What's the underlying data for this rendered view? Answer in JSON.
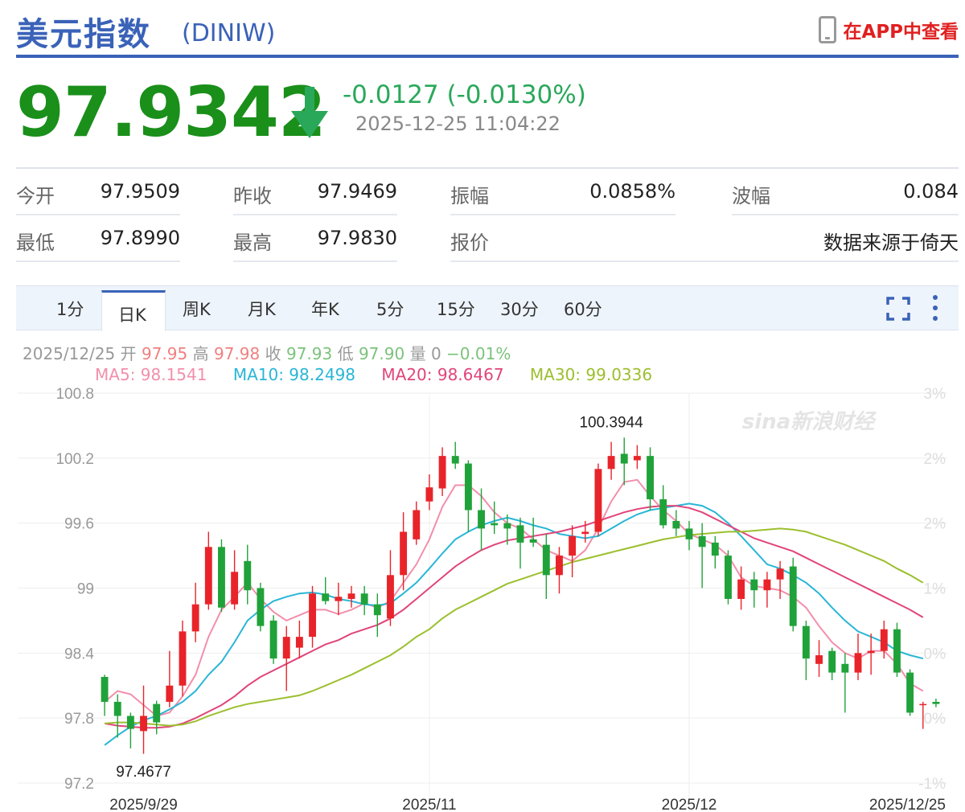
{
  "header": {
    "title": "美元指数",
    "code": "(DINIW)",
    "app_label": "在APP中查看",
    "icons": {
      "phone": "phone-icon"
    }
  },
  "quote": {
    "price": "97.9342",
    "change": "-0.0127 (-0.0130%)",
    "time": "2025-12-25 11:04:22",
    "direction": "down",
    "color": "#1a8f1a"
  },
  "stats": {
    "open_label": "今开",
    "open": "97.9509",
    "prev_close_label": "昨收",
    "prev_close": "97.9469",
    "amplitude_label": "振幅",
    "amplitude": "0.0858%",
    "range_label": "波幅",
    "range": "0.084",
    "low_label": "最低",
    "low": "97.8990",
    "high_label": "最高",
    "high": "97.9830",
    "quote_label": "报价",
    "source": "数据来源于倚天"
  },
  "tabs": [
    "1分",
    "日K",
    "周K",
    "月K",
    "年K",
    "5分",
    "15分",
    "30分",
    "60分"
  ],
  "active_tab": "日K",
  "info_bar": {
    "date": "2025/12/25",
    "open_label": "开",
    "open": "97.95",
    "high_label": "高",
    "high": "97.98",
    "close_label": "收",
    "close": "97.93",
    "low_label": "低",
    "low": "97.90",
    "vol_label": "量",
    "vol": "0",
    "pct": "−0.01%"
  },
  "ma_legend": [
    {
      "text": "MA5: 98.1541",
      "color": "#f28fab"
    },
    {
      "text": "MA10: 98.2498",
      "color": "#29b6d6"
    },
    {
      "text": "MA20: 98.6467",
      "color": "#e0457b"
    },
    {
      "text": "MA30: 99.0336",
      "color": "#9cbf2e"
    }
  ],
  "chart_data": {
    "type": "candlestick",
    "ylim": [
      97.2,
      100.8
    ],
    "yticks": [
      "100.8",
      "100.2",
      "99.6",
      "99",
      "98.4",
      "97.8",
      "97.2"
    ],
    "right_ticks": [
      "3%",
      "2%",
      "2%",
      "1%",
      "0%",
      "0%",
      "-1%"
    ],
    "xtick_labels": [
      "2025/9/29",
      "2025/11",
      "2025/12",
      "2025/12/25"
    ],
    "xtick_index": [
      3,
      25,
      45,
      61
    ],
    "annotations": [
      {
        "text": "97.4677",
        "index": 3,
        "value": 97.4677
      },
      {
        "text": "100.3944",
        "index": 39,
        "value": 100.3944
      }
    ],
    "watermark": "sina新浪财经",
    "colors": {
      "up": "#e8242a",
      "down": "#20a23a"
    },
    "candles": [
      {
        "o": 98.18,
        "h": 98.2,
        "l": 97.82,
        "c": 97.95
      },
      {
        "o": 97.95,
        "h": 98.02,
        "l": 97.62,
        "c": 97.82
      },
      {
        "o": 97.82,
        "h": 97.85,
        "l": 97.52,
        "c": 97.7
      },
      {
        "o": 97.68,
        "h": 98.1,
        "l": 97.47,
        "c": 97.82
      },
      {
        "o": 97.93,
        "h": 97.96,
        "l": 97.65,
        "c": 97.76
      },
      {
        "o": 97.95,
        "h": 98.42,
        "l": 97.9,
        "c": 98.1
      },
      {
        "o": 98.1,
        "h": 98.7,
        "l": 98.0,
        "c": 98.6
      },
      {
        "o": 98.6,
        "h": 99.05,
        "l": 98.5,
        "c": 98.85
      },
      {
        "o": 98.85,
        "h": 99.52,
        "l": 98.8,
        "c": 99.38
      },
      {
        "o": 99.38,
        "h": 99.45,
        "l": 98.78,
        "c": 98.82
      },
      {
        "o": 98.85,
        "h": 99.35,
        "l": 98.8,
        "c": 99.15
      },
      {
        "o": 99.25,
        "h": 99.4,
        "l": 98.85,
        "c": 98.98
      },
      {
        "o": 99.0,
        "h": 99.05,
        "l": 98.6,
        "c": 98.65
      },
      {
        "o": 98.7,
        "h": 98.75,
        "l": 98.3,
        "c": 98.35
      },
      {
        "o": 98.35,
        "h": 98.65,
        "l": 98.05,
        "c": 98.55
      },
      {
        "o": 98.45,
        "h": 98.7,
        "l": 98.35,
        "c": 98.55
      },
      {
        "o": 98.55,
        "h": 99.02,
        "l": 98.45,
        "c": 98.95
      },
      {
        "o": 98.95,
        "h": 99.1,
        "l": 98.85,
        "c": 98.88
      },
      {
        "o": 98.88,
        "h": 99.05,
        "l": 98.75,
        "c": 98.92
      },
      {
        "o": 98.9,
        "h": 99.02,
        "l": 98.82,
        "c": 98.95
      },
      {
        "o": 98.95,
        "h": 99.02,
        "l": 98.75,
        "c": 98.85
      },
      {
        "o": 98.85,
        "h": 98.95,
        "l": 98.55,
        "c": 98.75
      },
      {
        "o": 98.72,
        "h": 99.35,
        "l": 98.65,
        "c": 99.12
      },
      {
        "o": 99.12,
        "h": 99.7,
        "l": 98.98,
        "c": 99.52
      },
      {
        "o": 99.45,
        "h": 99.8,
        "l": 99.4,
        "c": 99.72
      },
      {
        "o": 99.8,
        "h": 100.05,
        "l": 99.72,
        "c": 99.93
      },
      {
        "o": 99.92,
        "h": 100.3,
        "l": 99.85,
        "c": 100.22
      },
      {
        "o": 100.22,
        "h": 100.35,
        "l": 100.1,
        "c": 100.15
      },
      {
        "o": 100.15,
        "h": 100.18,
        "l": 99.52,
        "c": 99.72
      },
      {
        "o": 99.72,
        "h": 99.92,
        "l": 99.35,
        "c": 99.55
      },
      {
        "o": 99.6,
        "h": 99.8,
        "l": 99.5,
        "c": 99.58
      },
      {
        "o": 99.6,
        "h": 99.68,
        "l": 99.4,
        "c": 99.55
      },
      {
        "o": 99.58,
        "h": 99.65,
        "l": 99.18,
        "c": 99.42
      },
      {
        "o": 99.45,
        "h": 99.65,
        "l": 99.38,
        "c": 99.42
      },
      {
        "o": 99.4,
        "h": 99.5,
        "l": 98.9,
        "c": 99.12
      },
      {
        "o": 99.12,
        "h": 99.38,
        "l": 98.95,
        "c": 99.3
      },
      {
        "o": 99.3,
        "h": 99.58,
        "l": 99.1,
        "c": 99.48
      },
      {
        "o": 99.5,
        "h": 99.62,
        "l": 99.42,
        "c": 99.52
      },
      {
        "o": 99.52,
        "h": 100.15,
        "l": 99.48,
        "c": 100.1
      },
      {
        "o": 100.1,
        "h": 100.35,
        "l": 100.0,
        "c": 100.22
      },
      {
        "o": 100.24,
        "h": 100.39,
        "l": 99.95,
        "c": 100.15
      },
      {
        "o": 100.18,
        "h": 100.32,
        "l": 100.1,
        "c": 100.22
      },
      {
        "o": 100.22,
        "h": 100.3,
        "l": 99.72,
        "c": 99.82
      },
      {
        "o": 99.82,
        "h": 99.95,
        "l": 99.55,
        "c": 99.58
      },
      {
        "o": 99.62,
        "h": 99.72,
        "l": 99.48,
        "c": 99.55
      },
      {
        "o": 99.55,
        "h": 99.62,
        "l": 99.35,
        "c": 99.45
      },
      {
        "o": 99.48,
        "h": 99.6,
        "l": 99.0,
        "c": 99.38
      },
      {
        "o": 99.42,
        "h": 99.48,
        "l": 99.18,
        "c": 99.3
      },
      {
        "o": 99.3,
        "h": 99.35,
        "l": 98.85,
        "c": 98.9
      },
      {
        "o": 98.9,
        "h": 99.2,
        "l": 98.8,
        "c": 99.08
      },
      {
        "o": 99.08,
        "h": 99.15,
        "l": 98.82,
        "c": 98.98
      },
      {
        "o": 98.98,
        "h": 99.15,
        "l": 98.82,
        "c": 99.08
      },
      {
        "o": 99.08,
        "h": 99.25,
        "l": 98.9,
        "c": 99.18
      },
      {
        "o": 99.2,
        "h": 99.28,
        "l": 98.6,
        "c": 98.65
      },
      {
        "o": 98.65,
        "h": 98.7,
        "l": 98.15,
        "c": 98.35
      },
      {
        "o": 98.3,
        "h": 98.52,
        "l": 98.18,
        "c": 98.38
      },
      {
        "o": 98.42,
        "h": 98.45,
        "l": 98.15,
        "c": 98.22
      },
      {
        "o": 98.3,
        "h": 98.4,
        "l": 97.85,
        "c": 98.22
      },
      {
        "o": 98.22,
        "h": 98.58,
        "l": 98.15,
        "c": 98.4
      },
      {
        "o": 98.4,
        "h": 98.58,
        "l": 98.2,
        "c": 98.42
      },
      {
        "o": 98.42,
        "h": 98.7,
        "l": 98.35,
        "c": 98.62
      },
      {
        "o": 98.62,
        "h": 98.68,
        "l": 98.18,
        "c": 98.22
      },
      {
        "o": 98.22,
        "h": 98.25,
        "l": 97.82,
        "c": 97.85
      },
      {
        "o": 97.92,
        "h": 97.95,
        "l": 97.7,
        "c": 97.93
      },
      {
        "o": 97.95,
        "h": 97.98,
        "l": 97.9,
        "c": 97.93
      }
    ],
    "ma_lines": [
      {
        "name": "MA5",
        "color": "#f28fab",
        "values": [
          97.95,
          98.05,
          98.02,
          97.92,
          97.82,
          97.85,
          98.0,
          98.2,
          98.55,
          98.8,
          98.92,
          99.05,
          98.9,
          98.78,
          98.7,
          98.75,
          98.8,
          98.8,
          98.76,
          98.8,
          98.86,
          98.82,
          98.88,
          99.05,
          99.22,
          99.45,
          99.75,
          99.95,
          99.95,
          99.85,
          99.7,
          99.6,
          99.55,
          99.45,
          99.35,
          99.3,
          99.25,
          99.35,
          99.55,
          99.8,
          99.98,
          100.0,
          99.85,
          99.72,
          99.62,
          99.5,
          99.45,
          99.4,
          99.3,
          99.1,
          99.02,
          99.0,
          98.98,
          98.92,
          98.82,
          98.65,
          98.5,
          98.4,
          98.35,
          98.42,
          98.42,
          98.3,
          98.12,
          98.05
        ]
      },
      {
        "name": "MA10",
        "color": "#29b6d6",
        "values": [
          97.55,
          97.64,
          97.72,
          97.78,
          97.82,
          97.88,
          97.95,
          98.05,
          98.2,
          98.32,
          98.5,
          98.7,
          98.8,
          98.88,
          98.92,
          98.95,
          98.96,
          98.94,
          98.9,
          98.88,
          98.85,
          98.84,
          98.86,
          98.95,
          99.05,
          99.18,
          99.32,
          99.45,
          99.52,
          99.58,
          99.62,
          99.65,
          99.62,
          99.58,
          99.55,
          99.5,
          99.48,
          99.46,
          99.48,
          99.55,
          99.62,
          99.68,
          99.72,
          99.74,
          99.76,
          99.78,
          99.76,
          99.7,
          99.6,
          99.48,
          99.35,
          99.22,
          99.18,
          99.12,
          99.05,
          98.95,
          98.82,
          98.7,
          98.6,
          98.55,
          98.5,
          98.42,
          98.38,
          98.35
        ]
      },
      {
        "name": "MA20",
        "color": "#e0457b",
        "values": [
          97.75,
          97.73,
          97.72,
          97.71,
          97.71,
          97.72,
          97.75,
          97.8,
          97.86,
          97.92,
          98.0,
          98.1,
          98.18,
          98.24,
          98.3,
          98.36,
          98.42,
          98.48,
          98.52,
          98.58,
          98.62,
          98.66,
          98.72,
          98.8,
          98.9,
          99.0,
          99.1,
          99.2,
          99.28,
          99.35,
          99.4,
          99.44,
          99.46,
          99.48,
          99.5,
          99.52,
          99.55,
          99.58,
          99.62,
          99.66,
          99.7,
          99.73,
          99.75,
          99.76,
          99.76,
          99.74,
          99.7,
          99.64,
          99.58,
          99.52,
          99.46,
          99.42,
          99.38,
          99.34,
          99.28,
          99.22,
          99.16,
          99.1,
          99.04,
          98.98,
          98.92,
          98.86,
          98.8,
          98.73
        ]
      },
      {
        "name": "MA30",
        "color": "#9cbf2e",
        "values": [
          97.75,
          97.76,
          97.76,
          97.75,
          97.74,
          97.73,
          97.74,
          97.77,
          97.82,
          97.86,
          97.9,
          97.93,
          97.95,
          97.97,
          97.99,
          98.01,
          98.05,
          98.1,
          98.15,
          98.2,
          98.26,
          98.32,
          98.38,
          98.46,
          98.55,
          98.62,
          98.72,
          98.8,
          98.86,
          98.92,
          98.98,
          99.04,
          99.08,
          99.12,
          99.16,
          99.2,
          99.24,
          99.27,
          99.3,
          99.33,
          99.36,
          99.39,
          99.42,
          99.45,
          99.47,
          99.49,
          99.5,
          99.51,
          99.52,
          99.52,
          99.53,
          99.54,
          99.55,
          99.54,
          99.52,
          99.48,
          99.44,
          99.4,
          99.35,
          99.3,
          99.25,
          99.18,
          99.12,
          99.05
        ]
      }
    ]
  }
}
